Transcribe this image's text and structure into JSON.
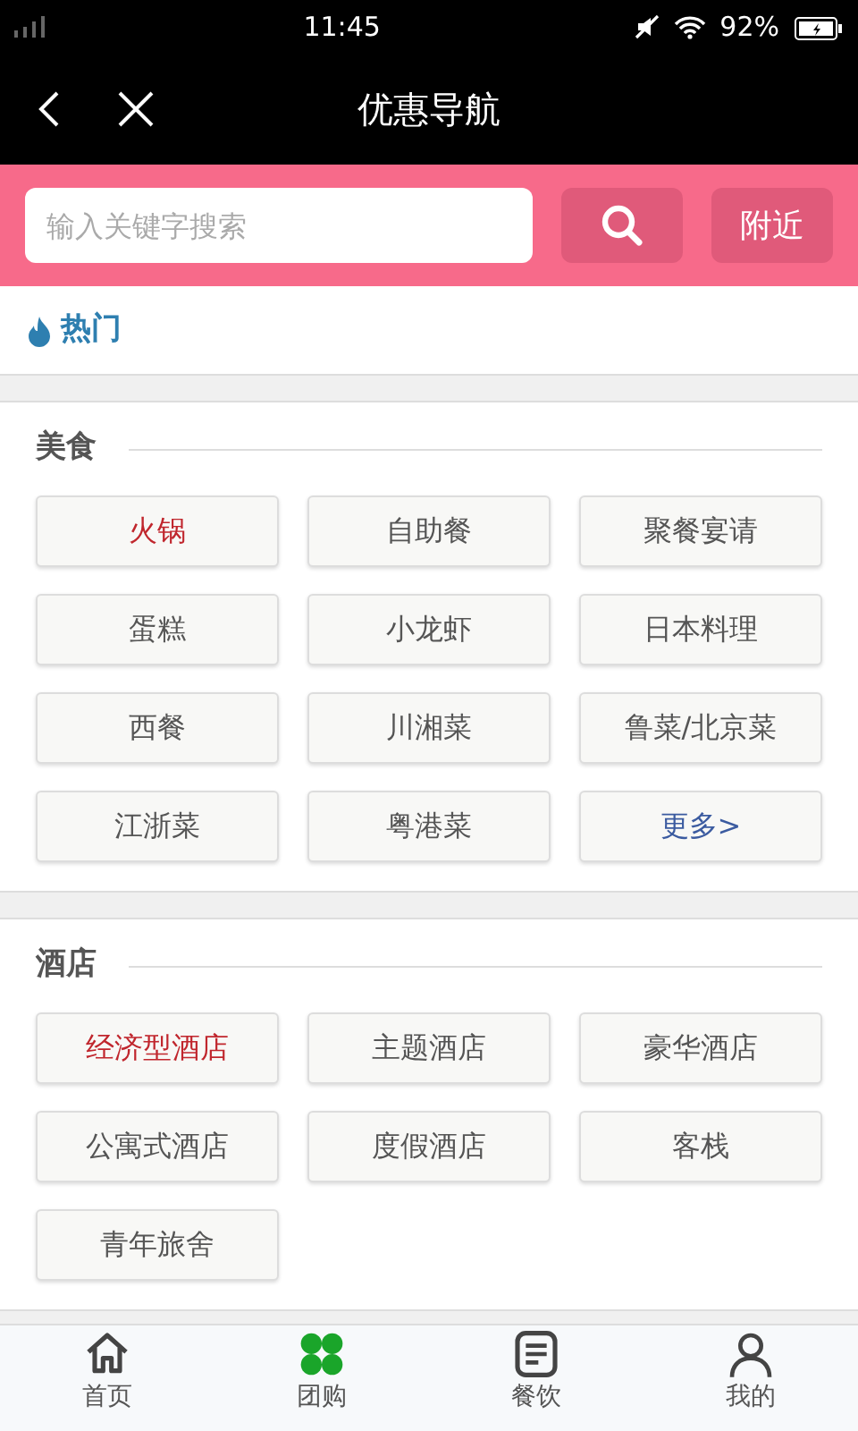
{
  "status_bar": {
    "time": "11:45",
    "battery": "92%"
  },
  "header": {
    "title": "优惠导航"
  },
  "search": {
    "placeholder": "输入关键字搜索",
    "nearby_button": "附近"
  },
  "hot": {
    "label": "热门"
  },
  "sections": [
    {
      "title": "美食",
      "tags": [
        {
          "label": "火锅",
          "kind": "highlight"
        },
        {
          "label": "自助餐",
          "kind": "normal"
        },
        {
          "label": "聚餐宴请",
          "kind": "normal"
        },
        {
          "label": "蛋糕",
          "kind": "normal"
        },
        {
          "label": "小龙虾",
          "kind": "normal"
        },
        {
          "label": "日本料理",
          "kind": "normal"
        },
        {
          "label": "西餐",
          "kind": "normal"
        },
        {
          "label": "川湘菜",
          "kind": "normal"
        },
        {
          "label": "鲁菜/北京菜",
          "kind": "normal"
        },
        {
          "label": "江浙菜",
          "kind": "normal"
        },
        {
          "label": "粤港菜",
          "kind": "normal"
        },
        {
          "label": "更多>",
          "kind": "more"
        }
      ]
    },
    {
      "title": "酒店",
      "tags": [
        {
          "label": "经济型酒店",
          "kind": "highlight"
        },
        {
          "label": "主题酒店",
          "kind": "normal"
        },
        {
          "label": "豪华酒店",
          "kind": "normal"
        },
        {
          "label": "公寓式酒店",
          "kind": "normal"
        },
        {
          "label": "度假酒店",
          "kind": "normal"
        },
        {
          "label": "客栈",
          "kind": "normal"
        },
        {
          "label": "青年旅舍",
          "kind": "normal"
        }
      ]
    }
  ],
  "tab_bar": [
    {
      "label": "首页",
      "kind": "home",
      "selected": false
    },
    {
      "label": "团购",
      "kind": "group",
      "selected": true
    },
    {
      "label": "餐饮",
      "kind": "dining",
      "selected": false
    },
    {
      "label": "我的",
      "kind": "profile",
      "selected": false
    }
  ]
}
